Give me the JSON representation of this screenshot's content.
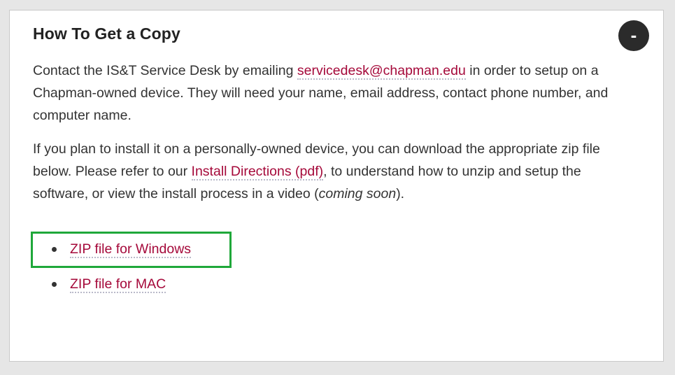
{
  "panel": {
    "title": "How To Get a Copy",
    "collapse_label": "-",
    "paragraph1": {
      "before_link": "Contact the IS&T Service Desk by emailing ",
      "email_link": "servicedesk@chapman.edu",
      "after_link": " in order to setup on a Chapman-owned device. They will need your  name, email address, contact phone number, and computer name."
    },
    "paragraph2": {
      "before_link": "If you plan to install it on a personally-owned device, you can download the appropriate zip file below. Please refer to our ",
      "install_link": "Install Directions (pdf)",
      "after_link": ", to understand how to unzip and setup the software, or view the install process in a video (",
      "italic": "coming soon",
      "end": ")."
    },
    "downloads": [
      {
        "label": "ZIP file for Windows"
      },
      {
        "label": "ZIP file for MAC"
      }
    ]
  },
  "colors": {
    "link": "#a5093a",
    "highlight_box": "#1fa83a",
    "button_bg": "#2b2b2b"
  }
}
